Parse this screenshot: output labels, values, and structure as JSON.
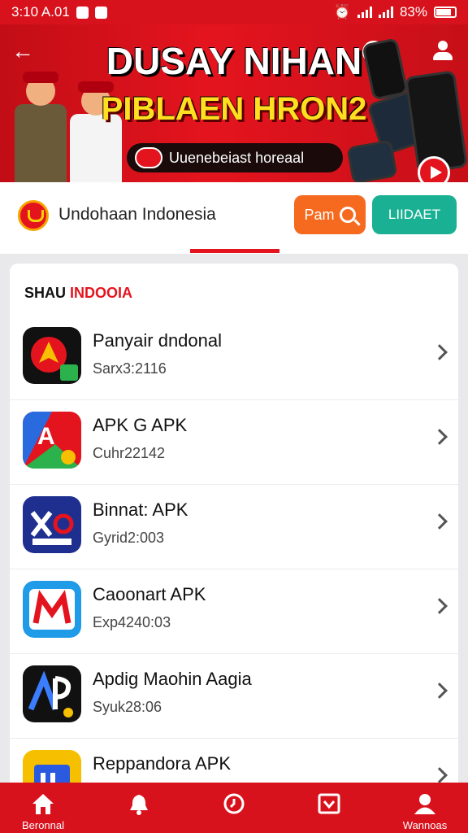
{
  "status_bar": {
    "time": "3:10 A.01",
    "battery": "83%"
  },
  "banner": {
    "title": "DUSAY NIHAN",
    "subtitle": "PIBLAEN HRON2",
    "pill_text": "Uuenebeiast horeaal"
  },
  "header": {
    "title": "Undohaan Indonesia",
    "search_label": "Pam",
    "update_label": "LIIDAET"
  },
  "section": {
    "title_dark": "SHAU",
    "title_red": "INDOOIA"
  },
  "apps": [
    {
      "name": "Panyair dndonal",
      "meta": "Sarx3:2116",
      "icon": "navigation-app-icon"
    },
    {
      "name": "APK G APK",
      "meta": "Cuhr22142",
      "icon": "apk-store-icon"
    },
    {
      "name": "Binnat: APK",
      "meta": "Gyrid2:003",
      "icon": "xa-app-icon"
    },
    {
      "name": "Caoonart APK",
      "meta": "Exp4240:03",
      "icon": "m-app-icon"
    },
    {
      "name": "Apdig Maohin Aagia",
      "meta": "Syuk28:06",
      "icon": "ap-app-icon"
    },
    {
      "name": "Reppandora APK",
      "meta": "",
      "icon": "folder-app-icon"
    }
  ],
  "nav": [
    {
      "label": "Beronnal",
      "icon": "home-icon"
    },
    {
      "label": "",
      "icon": "bell-icon"
    },
    {
      "label": "",
      "icon": "clock-icon"
    },
    {
      "label": "",
      "icon": "download-box-icon"
    },
    {
      "label": "Wannoas",
      "icon": "profile-icon"
    }
  ],
  "colors": {
    "primary_red": "#d8121c",
    "accent_yellow": "#ffe020",
    "search_orange": "#f56a1e",
    "update_teal": "#19b093"
  }
}
